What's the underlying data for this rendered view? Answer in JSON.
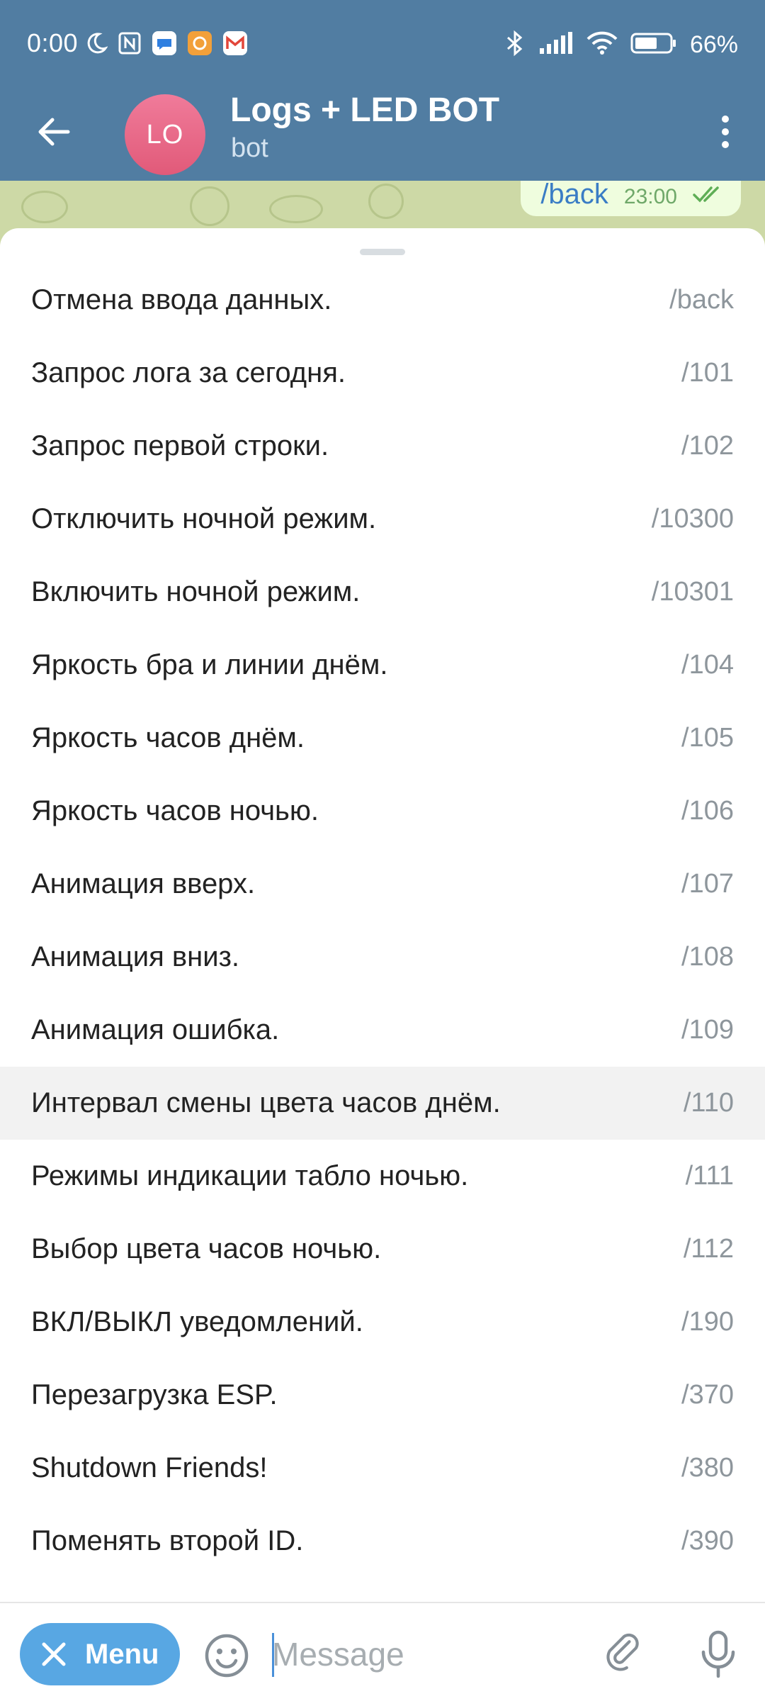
{
  "status_bar": {
    "time": "0:00",
    "battery_percent": "66%",
    "left_icons": [
      "moon-icon",
      "nfc-icon",
      "messenger-icon",
      "app-notification-icon",
      "gmail-icon"
    ],
    "right_icons": [
      "bluetooth-icon",
      "signal-icon",
      "wifi-icon",
      "battery-icon"
    ]
  },
  "header": {
    "avatar_initials": "LO",
    "title": "Logs + LED BOT",
    "subtitle": "bot",
    "avatar_color": "#e8678a",
    "bar_color": "#517da2"
  },
  "last_message": {
    "text": "/back",
    "time": "23:00",
    "status_icon": "double-check-icon"
  },
  "commands": [
    {
      "description": "Отмена ввода данных.",
      "command": "/back"
    },
    {
      "description": "Запрос лога за сегодня.",
      "command": "/101"
    },
    {
      "description": "Запрос первой строки.",
      "command": "/102"
    },
    {
      "description": "Отключить ночной режим.",
      "command": "/10300"
    },
    {
      "description": "Включить ночной режим.",
      "command": "/10301"
    },
    {
      "description": "Яркость бра и линии днём.",
      "command": "/104"
    },
    {
      "description": "Яркость часов днём.",
      "command": "/105"
    },
    {
      "description": "Яркость часов ночью.",
      "command": "/106"
    },
    {
      "description": "Анимация вверх.",
      "command": "/107"
    },
    {
      "description": "Анимация вниз.",
      "command": "/108"
    },
    {
      "description": "Анимация ошибка.",
      "command": "/109"
    },
    {
      "description": "Интервал смены цвета часов днём.",
      "command": "/110"
    },
    {
      "description": "Режимы индикации табло ночью.",
      "command": "/111"
    },
    {
      "description": "Выбор цвета часов ночью.",
      "command": "/112"
    },
    {
      "description": "ВКЛ/ВЫКЛ уведомлений.",
      "command": "/190"
    },
    {
      "description": "Перезагрузка ESP.",
      "command": "/370"
    },
    {
      "description": "Shutdown Friends!",
      "command": "/380"
    },
    {
      "description": "Поменять второй ID.",
      "command": "/390"
    }
  ],
  "highlighted_command_index": 11,
  "input_bar": {
    "menu_label": "Menu",
    "message_placeholder": "Message",
    "menu_color": "#58a7e3"
  }
}
